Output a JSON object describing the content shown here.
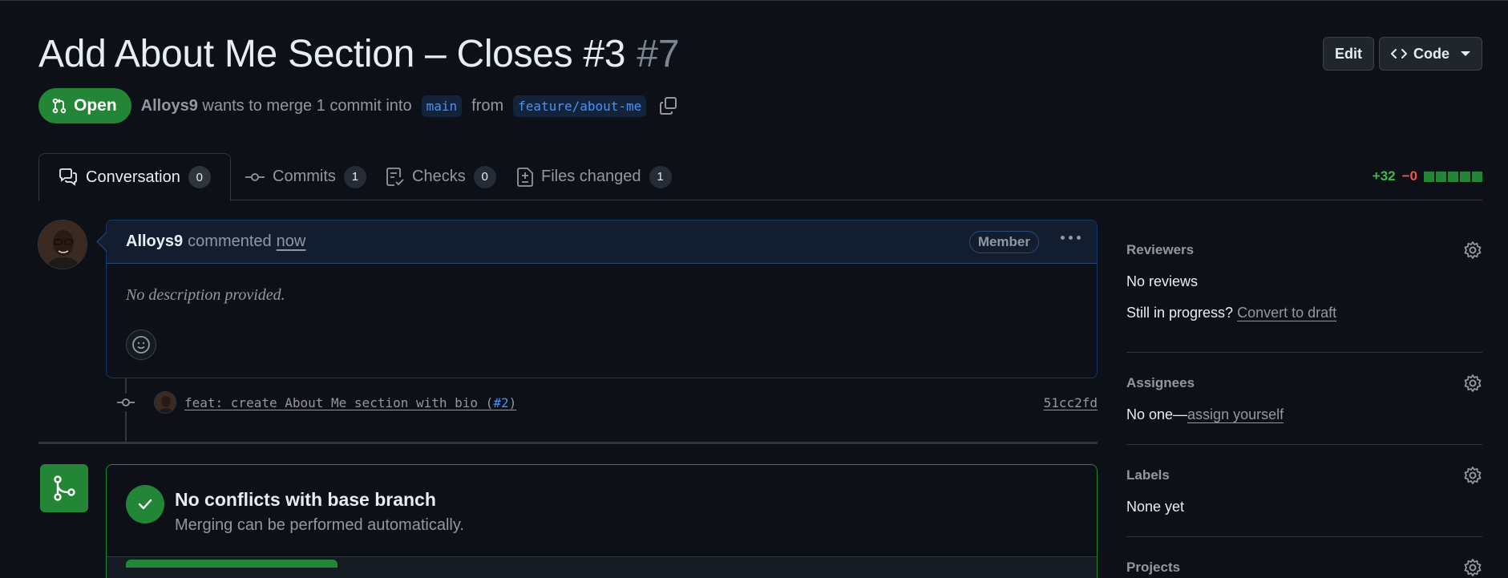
{
  "header": {
    "title": "Add About Me Section – Closes #3",
    "number": "#7",
    "edit_label": "Edit",
    "code_label": "Code"
  },
  "meta": {
    "state": "Open",
    "author": "Alloys9",
    "text_before": "wants to merge 1 commit into",
    "base_branch": "main",
    "from_text": "from",
    "head_branch": "feature/about-me"
  },
  "tabs": [
    {
      "label": "Conversation",
      "count": "0"
    },
    {
      "label": "Commits",
      "count": "1"
    },
    {
      "label": "Checks",
      "count": "0"
    },
    {
      "label": "Files changed",
      "count": "1"
    }
  ],
  "diffstat": {
    "additions": "+32",
    "deletions": "−0"
  },
  "comment": {
    "author": "Alloys9",
    "action": "commented",
    "time": "now",
    "badge": "Member",
    "body": "No description provided."
  },
  "commit": {
    "message_prefix": "feat: create About Me section with bio (",
    "ref": "#2",
    "message_suffix": ")",
    "sha": "51cc2fd"
  },
  "merge": {
    "title": "No conflicts with base branch",
    "subtitle": "Merging can be performed automatically."
  },
  "sidebar": {
    "reviewers": {
      "heading": "Reviewers",
      "value": "No reviews",
      "progress_text": "Still in progress?",
      "convert_link": "Convert to draft"
    },
    "assignees": {
      "heading": "Assignees",
      "value": "No one—",
      "assign_link": "assign yourself"
    },
    "labels": {
      "heading": "Labels",
      "value": "None yet"
    },
    "projects": {
      "heading": "Projects"
    }
  },
  "colors": {
    "open_green": "#238636",
    "link_blue": "#4493f8",
    "add_green": "#3fb950",
    "del_red": "#f85149",
    "background": "#0d1117"
  }
}
